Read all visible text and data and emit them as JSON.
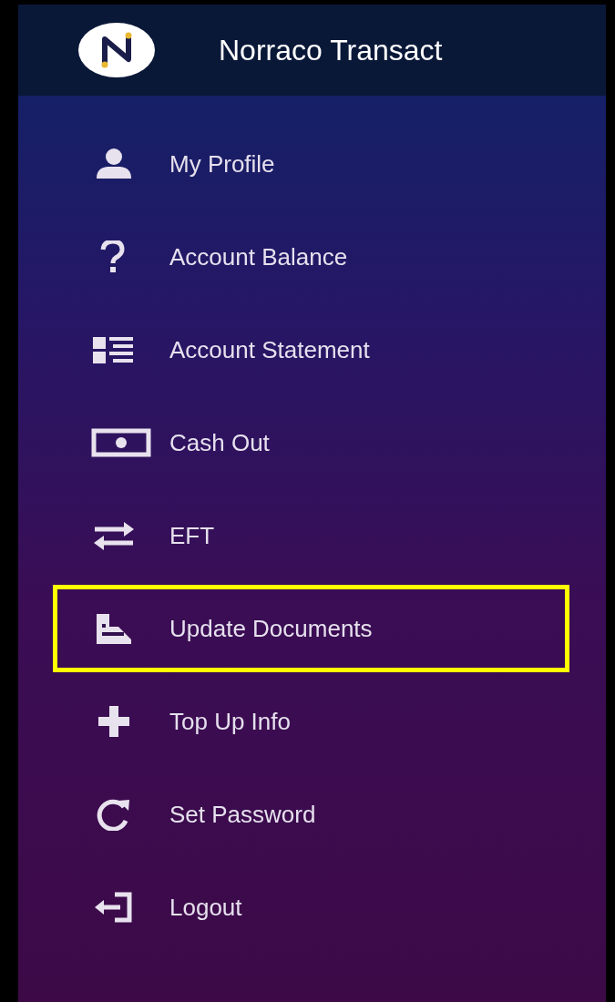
{
  "app": {
    "title": "Norraco Transact"
  },
  "menu": [
    {
      "label": "My Profile",
      "highlighted": false
    },
    {
      "label": "Account Balance",
      "highlighted": false
    },
    {
      "label": "Account Statement",
      "highlighted": false
    },
    {
      "label": "Cash Out",
      "highlighted": false
    },
    {
      "label": "EFT",
      "highlighted": false
    },
    {
      "label": "Update Documents",
      "highlighted": true
    },
    {
      "label": "Top Up Info",
      "highlighted": false
    },
    {
      "label": "Set Password",
      "highlighted": false
    },
    {
      "label": "Logout",
      "highlighted": false
    }
  ]
}
